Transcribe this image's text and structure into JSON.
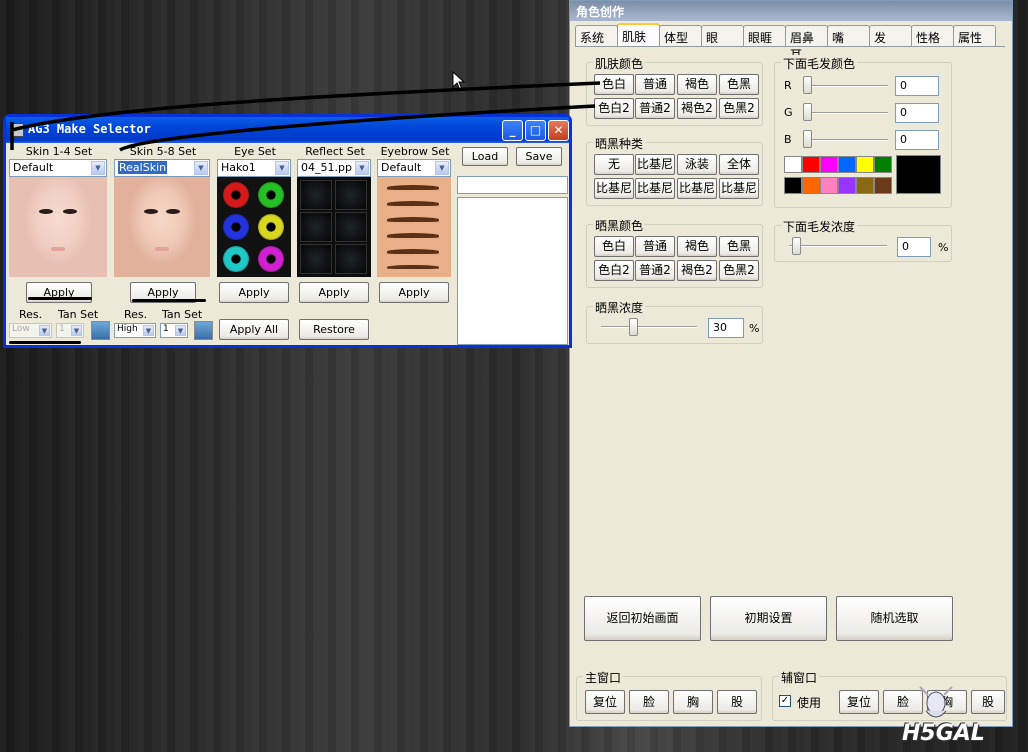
{
  "character_panel": {
    "title": "角色创作",
    "tabs": [
      "系统",
      "肌肤",
      "体型",
      "眼",
      "眼睚",
      "眉鼻耳",
      "嘴",
      "发",
      "性格",
      "属性"
    ],
    "active_tab": "肌肤",
    "skin_color": {
      "label": "肌肤颜色",
      "row1": [
        "色白",
        "普通",
        "褐色",
        "色黑"
      ],
      "row2": [
        "色白2",
        "普通2",
        "褐色2",
        "色黑2"
      ]
    },
    "tan_type": {
      "label": "晒黑种类",
      "row1": [
        "无",
        "比基尼",
        "泳装",
        "全体"
      ],
      "row2": [
        "比基尼",
        "比基尼",
        "比基尼",
        "比基尼"
      ]
    },
    "tan_color": {
      "label": "晒黑颜色",
      "row1": [
        "色白",
        "普通",
        "褐色",
        "色黑"
      ],
      "row2": [
        "色白2",
        "普通2",
        "褐色2",
        "色黑2"
      ]
    },
    "tan_density": {
      "label": "晒黑浓度",
      "value": "30",
      "unit": "%",
      "level": 0.3
    },
    "hair_color": {
      "label": "下面毛发颜色",
      "channels": [
        {
          "name": "R",
          "value": "0"
        },
        {
          "name": "G",
          "value": "0"
        },
        {
          "name": "B",
          "value": "0"
        }
      ],
      "palette_row1": [
        "#ffffff",
        "#ff0000",
        "#ff00ff",
        "#0066ff",
        "#ffff00",
        "#008000"
      ],
      "palette_row2": [
        "#000000",
        "#ff6600",
        "#ff80c0",
        "#9933ff",
        "#8b6914",
        "#6b3a1a"
      ],
      "preview_color": "#000000"
    },
    "hair_density": {
      "label": "下面毛发浓度",
      "value": "0",
      "unit": "%",
      "level": 0
    },
    "bottom_buttons": [
      "返回初始画面",
      "初期设置",
      "随机选取"
    ],
    "main_window": {
      "label": "主窗口",
      "buttons": [
        "复位",
        "脸",
        "胸",
        "股"
      ]
    },
    "sub_window": {
      "label": "辅窗口",
      "use_label": "使用",
      "use_checked": true,
      "buttons": [
        "复位",
        "脸",
        "胸",
        "股"
      ]
    }
  },
  "ag3": {
    "title": "AG3 Make Selector",
    "window_buttons": {
      "minimize": "_",
      "maximize": "□",
      "close": "✕"
    },
    "columns": [
      {
        "header": "Skin 1-4 Set",
        "value": "Default",
        "apply": "Apply"
      },
      {
        "header": "Skin 5-8 Set",
        "value": "RealSkin",
        "apply": "Apply"
      },
      {
        "header": "Eye Set",
        "value": "Hako1",
        "apply": "Apply"
      },
      {
        "header": "Reflect Set",
        "value": "04_51.pp",
        "apply": "Apply"
      },
      {
        "header": "Eyebrow Set",
        "value": "Default",
        "apply": "Apply"
      }
    ],
    "load": "Load",
    "save": "Save",
    "res1": {
      "res_label": "Res.",
      "tan_label": "Tan Set",
      "res_value": "Low",
      "tan_value": "1"
    },
    "res2": {
      "res_label": "Res.",
      "tan_label": "Tan Set",
      "res_value": "High",
      "tan_value": "1"
    },
    "apply_all": "Apply All",
    "restore": "Restore",
    "eye_colors": [
      "#d61a1a",
      "#26c026",
      "#2233e0",
      "#d8d820",
      "#20c8c8",
      "#d020d0"
    ]
  },
  "watermark": "H5GAL"
}
